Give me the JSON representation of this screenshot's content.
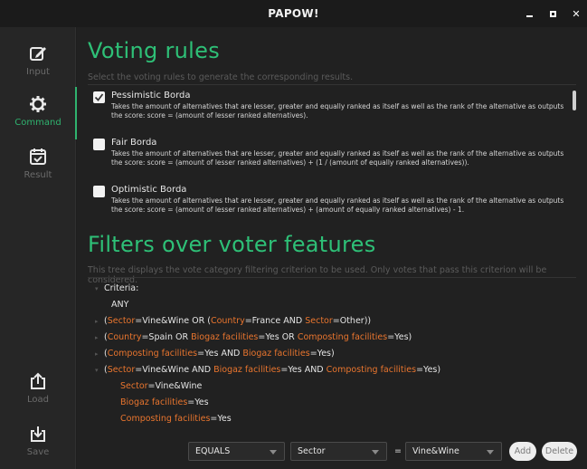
{
  "window": {
    "title": "PAPOW!"
  },
  "sidebar": {
    "items": [
      {
        "label": "Input",
        "icon": "edit-icon"
      },
      {
        "label": "Command",
        "icon": "gear-icon"
      },
      {
        "label": "Result",
        "icon": "calendar-check-icon"
      },
      {
        "label": "Load",
        "icon": "upload-icon"
      },
      {
        "label": "Save",
        "icon": "download-icon"
      }
    ]
  },
  "voting": {
    "title": "Voting rules",
    "hint": "Select the voting rules to generate the corresponding results.",
    "rules": [
      {
        "name": "Pessimistic Borda",
        "checked": true,
        "description": "Takes the amount of alternatives that are lesser, greater and equally ranked as itself as well as the rank of the alternative as outputs the score: score = (amount of lesser ranked alternatives)."
      },
      {
        "name": "Fair Borda",
        "checked": false,
        "description": "Takes the amount of alternatives that are lesser, greater and equally ranked as itself as well as the rank of the alternative as outputs the score: score = (amount of lesser ranked alternatives) + (1 / (amount of equally ranked alternatives))."
      },
      {
        "name": "Optimistic Borda",
        "checked": false,
        "description": "Takes the amount of alternatives that are lesser, greater and equally ranked as itself as well as the rank of the alternative as outputs the score: score = (amount of lesser ranked alternatives) + (amount of equally ranked alternatives) - 1."
      }
    ]
  },
  "filters": {
    "title": "Filters over voter features",
    "hint": "This tree displays the vote category filtering criterion to be used. Only votes that pass this criterion will be considered.",
    "root": "Criteria:",
    "any": "ANY",
    "groups": [
      [
        {
          "t": "("
        },
        {
          "f": "Sector"
        },
        {
          "t": "=Vine&Wine OR ("
        },
        {
          "f": "Country"
        },
        {
          "t": "=France AND "
        },
        {
          "f": "Sector"
        },
        {
          "t": "=Other))"
        }
      ],
      [
        {
          "t": "("
        },
        {
          "f": "Country"
        },
        {
          "t": "=Spain OR "
        },
        {
          "f": "Biogaz facilities"
        },
        {
          "t": "=Yes OR "
        },
        {
          "f": "Composting facilities"
        },
        {
          "t": "=Yes)"
        }
      ],
      [
        {
          "t": "("
        },
        {
          "f": "Composting facilities"
        },
        {
          "t": "=Yes AND "
        },
        {
          "f": "Biogaz facilities"
        },
        {
          "t": "=Yes)"
        }
      ],
      [
        {
          "t": "("
        },
        {
          "f": "Sector"
        },
        {
          "t": "=Vine&Wine AND "
        },
        {
          "f": "Biogaz facilities"
        },
        {
          "t": "=Yes AND "
        },
        {
          "f": "Composting facilities"
        },
        {
          "t": "=Yes)"
        }
      ]
    ],
    "children": [
      [
        {
          "f": "Sector"
        },
        {
          "t": "=Vine&Wine"
        }
      ],
      [
        {
          "f": "Biogaz facilities"
        },
        {
          "t": "=Yes"
        }
      ],
      [
        {
          "f": "Composting facilities"
        },
        {
          "t": "=Yes"
        }
      ]
    ]
  },
  "editor": {
    "operator": "EQUALS",
    "feature": "Sector",
    "equals_sign": "=",
    "value": "Vine&Wine",
    "add_label": "Add",
    "delete_label": "Delete"
  },
  "colors": {
    "accent": "#2ec077",
    "feature": "#e9752e"
  }
}
